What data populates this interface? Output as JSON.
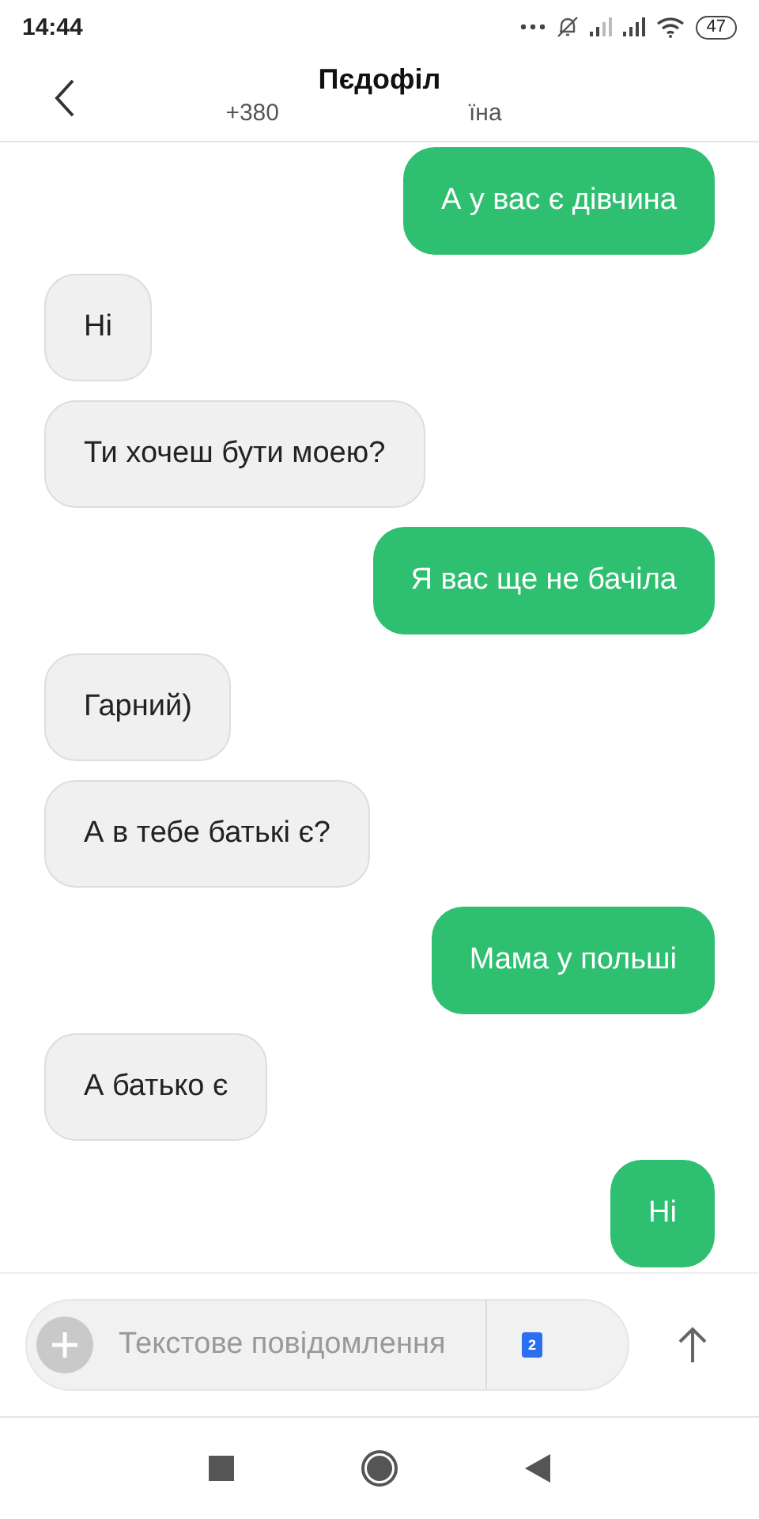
{
  "status_bar": {
    "time": "14:44",
    "battery": "47"
  },
  "header": {
    "title": "Пєдофіл",
    "subtitle_start": "+380",
    "subtitle_end": "їна"
  },
  "messages": [
    {
      "text": "А у вас є дівчина",
      "kind": "sent"
    },
    {
      "text": "Ні",
      "kind": "received"
    },
    {
      "text": "Ти хочеш бути моею?",
      "kind": "received"
    },
    {
      "text": "Я вас ще не бачіла",
      "kind": "sent"
    },
    {
      "text": "Гарний)",
      "kind": "received"
    },
    {
      "text": "А в тебе батькі є?",
      "kind": "received"
    },
    {
      "text": "Мама у польші",
      "kind": "sent"
    },
    {
      "text": "А батько є",
      "kind": "received"
    },
    {
      "text": "Ні",
      "kind": "sent"
    }
  ],
  "composer": {
    "placeholder": "Текстове повідомлення",
    "sim": "2"
  }
}
